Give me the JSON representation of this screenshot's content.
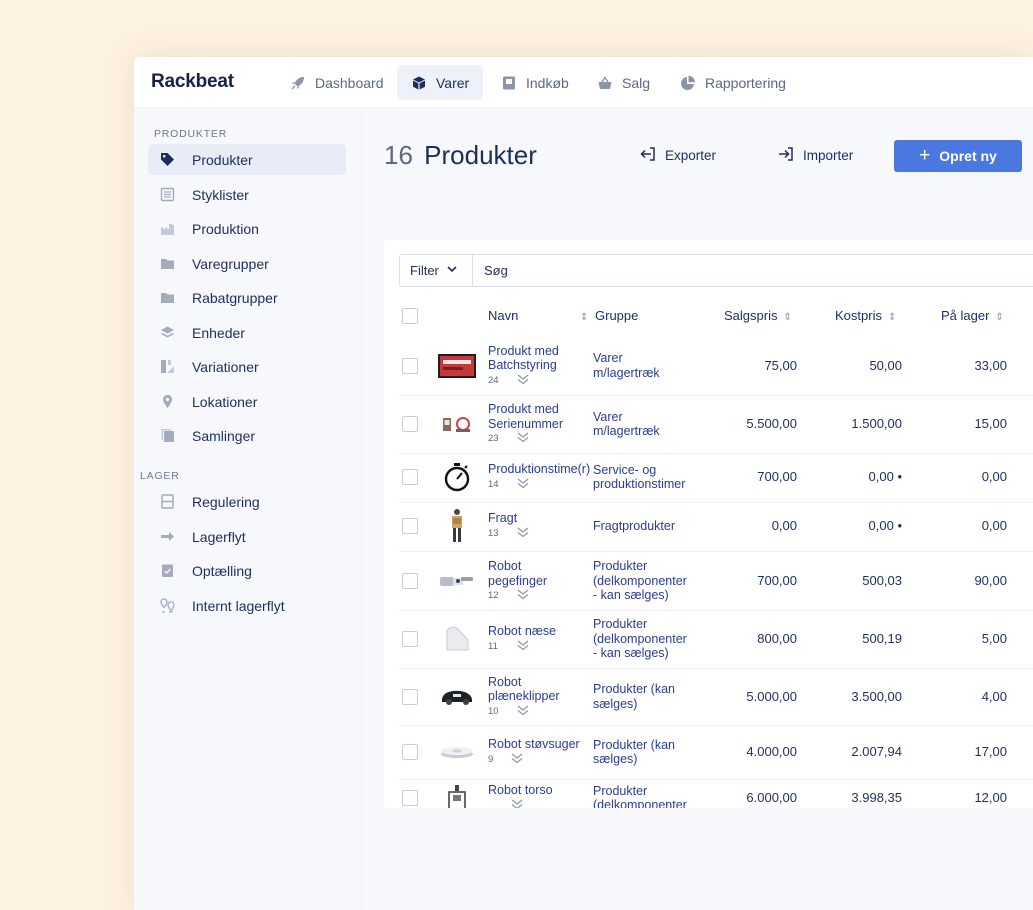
{
  "app": {
    "logo": "Rackbeat"
  },
  "nav": {
    "tabs": [
      {
        "label": "Dashboard",
        "icon": "rocket-icon"
      },
      {
        "label": "Varer",
        "icon": "box-icon",
        "active": true
      },
      {
        "label": "Indkøb",
        "icon": "inbox-icon"
      },
      {
        "label": "Salg",
        "icon": "basket-icon"
      },
      {
        "label": "Rapportering",
        "icon": "pie-chart-icon"
      }
    ]
  },
  "sidebar": {
    "section_products": "PRODUKTER",
    "section_stock": "LAGER",
    "items": [
      {
        "label": "Produkter",
        "icon": "tag-icon",
        "active": true
      },
      {
        "label": "Styklister",
        "icon": "list-icon"
      },
      {
        "label": "Produktion",
        "icon": "factory-icon"
      },
      {
        "label": "Varegrupper",
        "icon": "folder-icon"
      },
      {
        "label": "Rabatgrupper",
        "icon": "folder-icon"
      },
      {
        "label": "Enheder",
        "icon": "layers-icon"
      },
      {
        "label": "Variationer",
        "icon": "variations-icon"
      },
      {
        "label": "Lokationer",
        "icon": "pin-icon"
      },
      {
        "label": "Samlinger",
        "icon": "collection-icon"
      },
      {
        "label": "Regulering",
        "icon": "adjust-icon"
      },
      {
        "label": "Lagerflyt",
        "icon": "arrow-right-icon"
      },
      {
        "label": "Optælling",
        "icon": "clipboard-icon"
      },
      {
        "label": "Internt lagerflyt",
        "icon": "pins-icon"
      }
    ]
  },
  "main": {
    "count": "16",
    "title": "Produkter",
    "export_label": "Exporter",
    "import_label": "Importer",
    "create_label": "Opret ny",
    "filter_label": "Filter",
    "search_placeholder": "Søg",
    "columns": {
      "name": "Navn",
      "group": "Gruppe",
      "sale_price": "Salgspris",
      "cost_price": "Kostpris",
      "stock": "På lager"
    },
    "rows": [
      {
        "name1": "Produkt med",
        "name2": "Batchstyring",
        "num": "24",
        "group1": "Varer",
        "group2": "m/lagertræk",
        "group3": "",
        "sale": "75,00",
        "cost": "50,00",
        "stock": "33,00",
        "thumb": "battery-pack"
      },
      {
        "name1": "Produkt med",
        "name2": "Serienummer",
        "num": "23",
        "group1": "Varer",
        "group2": "m/lagertræk",
        "group3": "",
        "sale": "5.500,00",
        "cost": "1.500,00",
        "stock": "15,00",
        "thumb": "devices"
      },
      {
        "name1": "Produktionstime(r)",
        "name2": "",
        "num": "14",
        "group1": "Service- og",
        "group2": "produktionstimer",
        "group3": "",
        "sale": "700,00",
        "cost": "0,00 •",
        "stock": "0,00",
        "thumb": "stopwatch"
      },
      {
        "name1": "Fragt",
        "name2": "",
        "num": "13",
        "group1": "Fragtprodukter",
        "group2": "",
        "group3": "",
        "sale": "0,00",
        "cost": "0,00 •",
        "stock": "0,00",
        "thumb": "delivery-person"
      },
      {
        "name1": "Robot",
        "name2": "pegefinger",
        "num": "12",
        "group1": "Produkter",
        "group2": "(delkomponenter",
        "group3": "- kan sælges)",
        "sale": "700,00",
        "cost": "500,03",
        "stock": "90,00",
        "thumb": "robot-hand"
      },
      {
        "name1": "Robot næse",
        "name2": "",
        "num": "11",
        "group1": "Produkter",
        "group2": "(delkomponenter",
        "group3": "- kan sælges)",
        "sale": "800,00",
        "cost": "500,19",
        "stock": "5,00",
        "thumb": "robot-nose"
      },
      {
        "name1": "Robot",
        "name2": "plæneklipper",
        "num": "10",
        "group1": "Produkter (kan",
        "group2": "sælges)",
        "group3": "",
        "sale": "5.000,00",
        "cost": "3.500,00",
        "stock": "4,00",
        "thumb": "robot-mower"
      },
      {
        "name1": "Robot støvsuger",
        "name2": "",
        "num": "9",
        "group1": "Produkter (kan",
        "group2": "sælges)",
        "group3": "",
        "sale": "4.000,00",
        "cost": "2.007,94",
        "stock": "17,00",
        "thumb": "robot-vacuum"
      },
      {
        "name1": "Robot torso",
        "name2": "",
        "num": "",
        "group1": "Produkter",
        "group2": "(delkomponenter",
        "group3": "",
        "sale": "6.000,00",
        "cost": "3.998,35",
        "stock": "12,00",
        "thumb": "robot-torso"
      }
    ]
  }
}
